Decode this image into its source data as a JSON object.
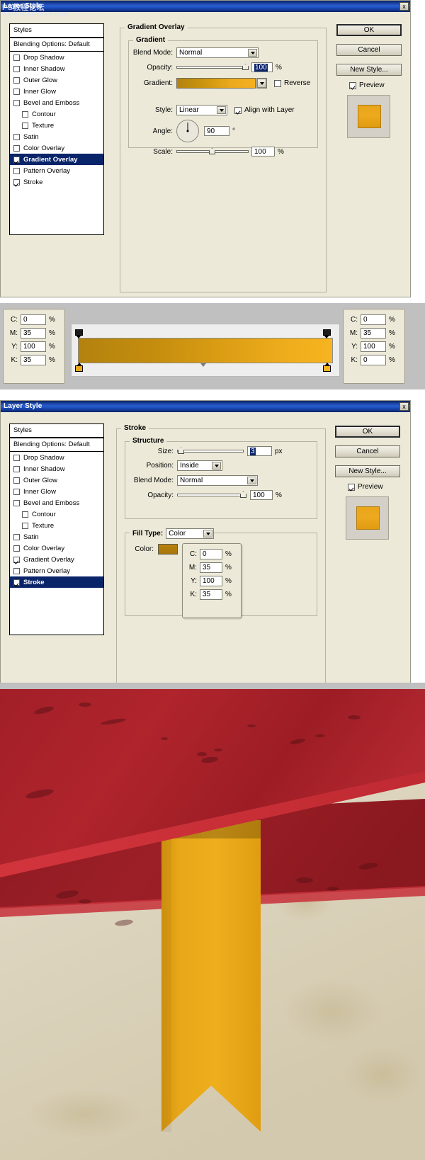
{
  "window1": {
    "title": "Layer Style",
    "watermark": "PS教程论坛",
    "watermark_sub": "WWW.MISSYUAN.COM",
    "close_label": "x",
    "styles_list": {
      "header": "Styles",
      "blending_options": "Blending Options: Default",
      "items": [
        {
          "label": "Drop Shadow",
          "checked": false,
          "sub": false,
          "selected": false
        },
        {
          "label": "Inner Shadow",
          "checked": false,
          "sub": false,
          "selected": false
        },
        {
          "label": "Outer Glow",
          "checked": false,
          "sub": false,
          "selected": false
        },
        {
          "label": "Inner Glow",
          "checked": false,
          "sub": false,
          "selected": false
        },
        {
          "label": "Bevel and Emboss",
          "checked": false,
          "sub": false,
          "selected": false
        },
        {
          "label": "Contour",
          "checked": false,
          "sub": true,
          "selected": false
        },
        {
          "label": "Texture",
          "checked": false,
          "sub": true,
          "selected": false
        },
        {
          "label": "Satin",
          "checked": false,
          "sub": false,
          "selected": false
        },
        {
          "label": "Color Overlay",
          "checked": false,
          "sub": false,
          "selected": false
        },
        {
          "label": "Gradient Overlay",
          "checked": true,
          "sub": false,
          "selected": true
        },
        {
          "label": "Pattern Overlay",
          "checked": false,
          "sub": false,
          "selected": false
        },
        {
          "label": "Stroke",
          "checked": true,
          "sub": false,
          "selected": false
        }
      ]
    },
    "panel": {
      "group_title": "Gradient Overlay",
      "sub_group_title": "Gradient",
      "blend_mode_label": "Blend Mode:",
      "blend_mode_value": "Normal",
      "opacity_label": "Opacity:",
      "opacity_value": "100",
      "opacity_unit": "%",
      "gradient_label": "Gradient:",
      "reverse_label": "Reverse",
      "reverse_checked": false,
      "style_label": "Style:",
      "style_value": "Linear",
      "align_label": "Align with Layer",
      "align_checked": true,
      "angle_label": "Angle:",
      "angle_value": "90",
      "angle_unit": "°",
      "scale_label": "Scale:",
      "scale_value": "100",
      "scale_unit": "%"
    },
    "buttons": {
      "ok": "OK",
      "cancel": "Cancel",
      "new_style": "New Style...",
      "preview": "Preview",
      "preview_checked": true
    }
  },
  "gradient_editor": {
    "left_color": {
      "c_label": "C:",
      "c_value": "0",
      "m_label": "M:",
      "m_value": "35",
      "y_label": "Y:",
      "y_value": "100",
      "k_label": "K:",
      "k_value": "35",
      "unit": "%"
    },
    "right_color": {
      "c_label": "C:",
      "c_value": "0",
      "m_label": "M:",
      "m_value": "35",
      "y_label": "Y:",
      "y_value": "100",
      "k_label": "K:",
      "k_value": "0",
      "unit": "%"
    },
    "gradient_start_hex": "#b3820e",
    "gradient_end_hex": "#f7b420"
  },
  "window2": {
    "title": "Layer Style",
    "close_label": "x",
    "styles_list": {
      "header": "Styles",
      "blending_options": "Blending Options: Default",
      "items": [
        {
          "label": "Drop Shadow",
          "checked": false,
          "sub": false,
          "selected": false
        },
        {
          "label": "Inner Shadow",
          "checked": false,
          "sub": false,
          "selected": false
        },
        {
          "label": "Outer Glow",
          "checked": false,
          "sub": false,
          "selected": false
        },
        {
          "label": "Inner Glow",
          "checked": false,
          "sub": false,
          "selected": false
        },
        {
          "label": "Bevel and Emboss",
          "checked": false,
          "sub": false,
          "selected": false
        },
        {
          "label": "Contour",
          "checked": false,
          "sub": true,
          "selected": false
        },
        {
          "label": "Texture",
          "checked": false,
          "sub": true,
          "selected": false
        },
        {
          "label": "Satin",
          "checked": false,
          "sub": false,
          "selected": false
        },
        {
          "label": "Color Overlay",
          "checked": false,
          "sub": false,
          "selected": false
        },
        {
          "label": "Gradient Overlay",
          "checked": true,
          "sub": false,
          "selected": false
        },
        {
          "label": "Pattern Overlay",
          "checked": false,
          "sub": false,
          "selected": false
        },
        {
          "label": "Stroke",
          "checked": true,
          "sub": false,
          "selected": true
        }
      ]
    },
    "panel": {
      "group_title": "Stroke",
      "sub_group_title": "Structure",
      "size_label": "Size:",
      "size_value": "3",
      "size_unit": "px",
      "position_label": "Position:",
      "position_value": "Inside",
      "blend_mode_label": "Blend Mode:",
      "blend_mode_value": "Normal",
      "opacity_label": "Opacity:",
      "opacity_value": "100",
      "opacity_unit": "%",
      "fill_type_label": "Fill Type:",
      "fill_type_value": "Color",
      "color_label": "Color:",
      "color_hex": "#b9830f",
      "color_popup": {
        "c_label": "C:",
        "c_value": "0",
        "m_label": "M:",
        "m_value": "35",
        "y_label": "Y:",
        "y_value": "100",
        "k_label": "K:",
        "k_value": "35",
        "unit": "%"
      }
    },
    "buttons": {
      "ok": "OK",
      "cancel": "Cancel",
      "new_style": "New Style...",
      "preview": "Preview",
      "preview_checked": true
    }
  },
  "result_image": {
    "description": "Red grunge banner over paper background with a yellow-gold ribbon bookmark",
    "ribbon_hex": "#e9a81b",
    "banner_hex": "#a8212a",
    "paper_hex": "#ded7c4"
  }
}
